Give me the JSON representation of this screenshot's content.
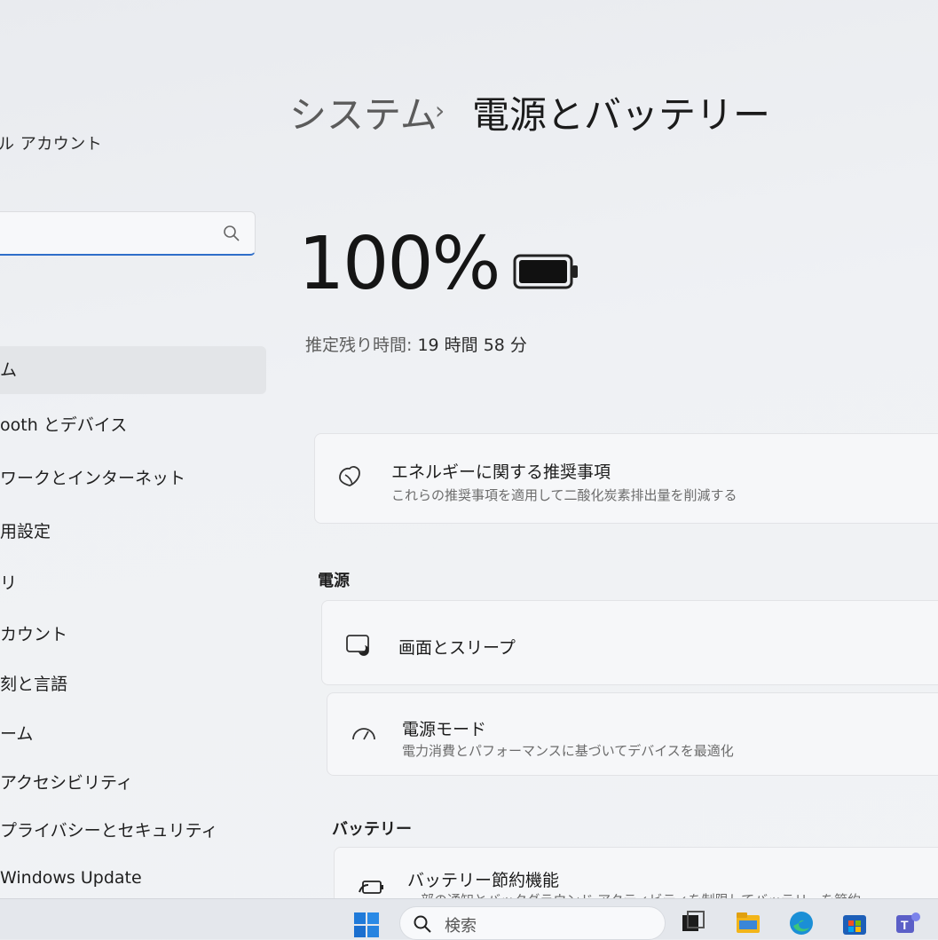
{
  "sidebar": {
    "user_name": "ル アカウント",
    "search": {
      "placeholder": ""
    },
    "items": [
      {
        "label": "ム",
        "selected": true
      },
      {
        "label": "ooth とデバイス"
      },
      {
        "label": "ワークとインターネット"
      },
      {
        "label": "用設定"
      },
      {
        "label": "リ"
      },
      {
        "label": "カウント"
      },
      {
        "label": "刻と言語"
      },
      {
        "label": "ーム"
      },
      {
        "label": "アクセシビリティ"
      },
      {
        "label": "プライバシーとセキュリティ"
      },
      {
        "label": "Windows Update"
      }
    ]
  },
  "breadcrumb": {
    "parent": "システム",
    "separator": "›",
    "current": "電源とバッテリー"
  },
  "battery": {
    "percent": "100%",
    "level": 1.0,
    "remaining_label": "推定残り時間:",
    "remaining_value": "19 時間 58 分"
  },
  "energy_card": {
    "title": "エネルギーに関する推奨事項",
    "subtitle": "これらの推奨事項を適用して二酸化炭素排出量を削減する",
    "icon": "leaf-icon"
  },
  "power_section": {
    "title": "電源",
    "items": [
      {
        "title": "画面とスリープ",
        "icon": "screen-sleep-icon"
      },
      {
        "title": "電源モード",
        "subtitle": "電力消費とパフォーマンスに基づいてデバイスを最適化",
        "icon": "gauge-icon"
      }
    ]
  },
  "battery_section": {
    "title": "バッテリー",
    "items": [
      {
        "title": "バッテリー節約機能",
        "subtitle": "一部の通知とバックグラウンド アクティビティを制限してバッテリーを節約",
        "icon": "battery-saver-icon"
      }
    ]
  },
  "taskbar": {
    "search_label": "検索",
    "icons": [
      "windows-start-icon",
      "search-icon",
      "task-view-icon",
      "file-explorer-icon",
      "edge-icon",
      "store-icon",
      "teams-icon"
    ]
  },
  "colors": {
    "accent": "#2f6ec9",
    "background": "#eef0f3",
    "card": "#f6f7f9"
  }
}
